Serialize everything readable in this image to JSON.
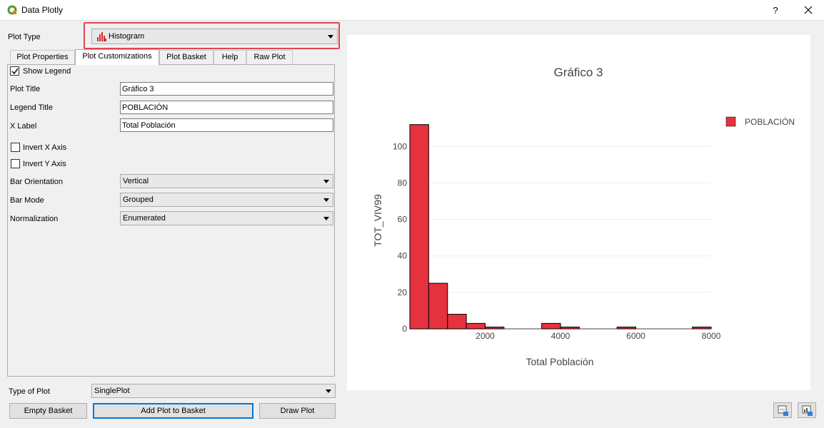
{
  "window": {
    "title": "Data Plotly",
    "help_label": "?"
  },
  "plot_type": {
    "label": "Plot Type",
    "value": "Histogram"
  },
  "tabs": [
    {
      "label": "Plot Properties",
      "active": false
    },
    {
      "label": "Plot Customizations",
      "active": true
    },
    {
      "label": "Plot Basket",
      "active": false
    },
    {
      "label": "Help",
      "active": false
    },
    {
      "label": "Raw Plot",
      "active": false
    }
  ],
  "customizations": {
    "show_legend": {
      "label": "Show Legend",
      "checked": true
    },
    "plot_title": {
      "label": "Plot Title",
      "value": "Gráfico 3"
    },
    "legend_title": {
      "label": "Legend Title",
      "value": "POBLACIÓN"
    },
    "x_label": {
      "label": "X Label",
      "value": "Total Población"
    },
    "invert_x": {
      "label": "Invert X Axis",
      "checked": false
    },
    "invert_y": {
      "label": "Invert Y Axis",
      "checked": false
    },
    "bar_orientation": {
      "label": "Bar Orientation",
      "value": "Vertical"
    },
    "bar_mode": {
      "label": "Bar Mode",
      "value": "Grouped"
    },
    "normalization": {
      "label": "Normalization",
      "value": "Enumerated"
    }
  },
  "bottom": {
    "type_of_plot_label": "Type of Plot",
    "type_of_plot_value": "SinglePlot",
    "empty_basket": "Empty Basket",
    "add_plot": "Add Plot to Basket",
    "draw_plot": "Draw Plot"
  },
  "icons": {
    "app": "qgis-logo-icon",
    "plot_type": "histogram-icon",
    "close": "close-icon",
    "tool_1": "export-plot-icon",
    "tool_2": "save-plot-icon"
  },
  "colors": {
    "bar_fill": "#e6313f",
    "bar_stroke": "#000000",
    "highlight": "#e0464f",
    "accent": "#0078d7"
  },
  "chart_data": {
    "type": "bar",
    "title": "Gráfico 3",
    "xlabel": "Total Población",
    "ylabel": "TOT_VIV99",
    "legend": [
      "POBLACIÓN"
    ],
    "legend_position": "top-right",
    "bin_width": 500,
    "bins_start": [
      0,
      500,
      1000,
      1500,
      2000,
      2500,
      3000,
      3500,
      4000,
      4500,
      5000,
      5500,
      6000,
      6500,
      7000,
      7500
    ],
    "values": [
      112,
      25,
      8,
      3,
      1,
      0,
      0,
      3,
      1,
      0,
      0,
      1,
      0,
      0,
      0,
      1
    ],
    "xlim": [
      0,
      8000
    ],
    "ylim": [
      0,
      115
    ],
    "xticks": [
      2000,
      4000,
      6000,
      8000
    ],
    "yticks": [
      0,
      20,
      40,
      60,
      80,
      100
    ],
    "grid": true
  }
}
